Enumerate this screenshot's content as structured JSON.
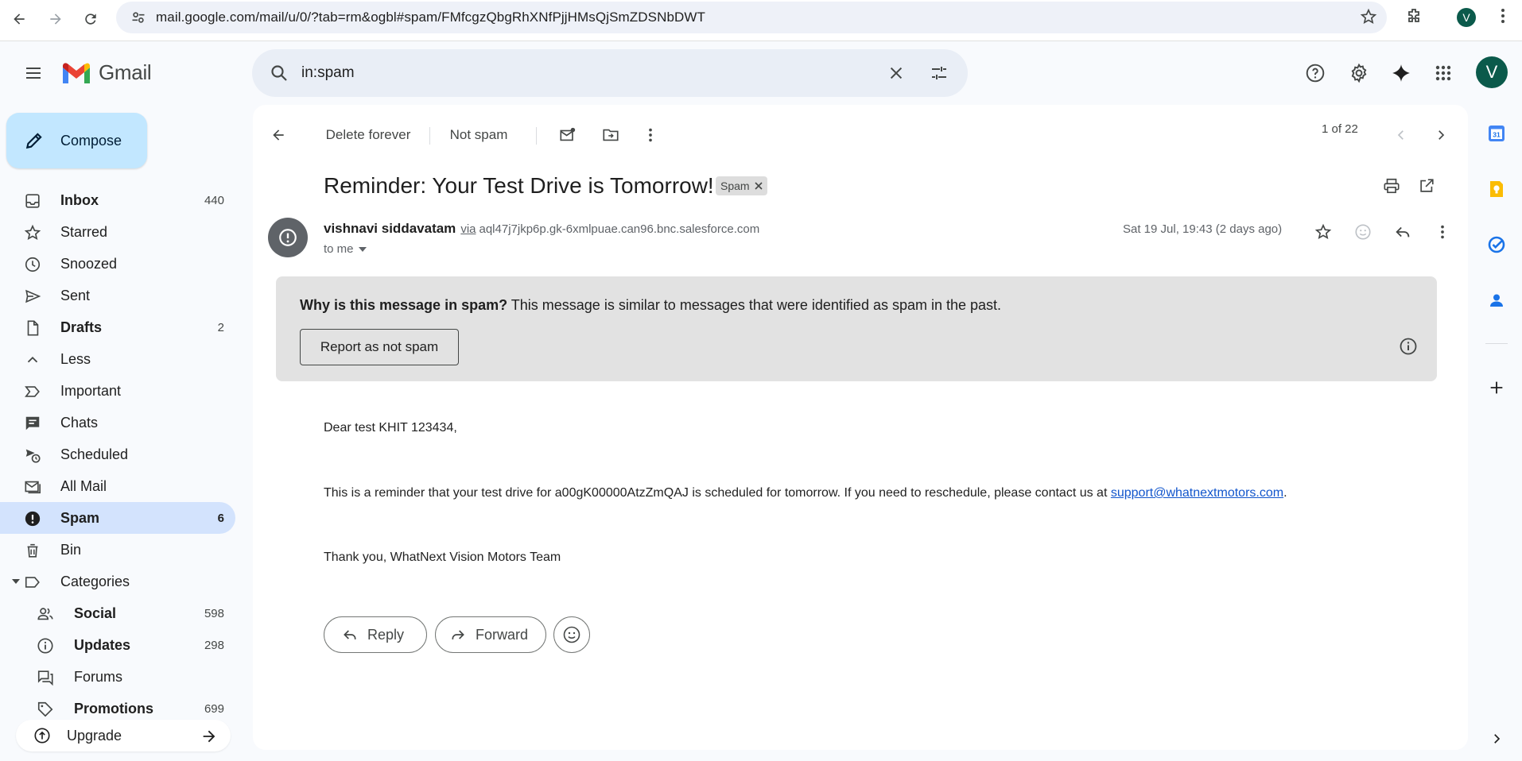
{
  "browser": {
    "url": "mail.google.com/mail/u/0/?tab=rm&ogbl#spam/FMfcgzQbgRhXNfPjjHMsQjSmZDSNbDWT",
    "profile_initial": "V"
  },
  "app": {
    "name": "Gmail",
    "account_initial": "V"
  },
  "search": {
    "value": "in:spam"
  },
  "compose": {
    "label": "Compose"
  },
  "sidebar": {
    "items": [
      {
        "label": "Inbox",
        "count": "440",
        "icon": "inbox-icon"
      },
      {
        "label": "Starred",
        "count": "",
        "icon": "star-icon"
      },
      {
        "label": "Snoozed",
        "count": "",
        "icon": "clock-icon"
      },
      {
        "label": "Sent",
        "count": "",
        "icon": "send-icon"
      },
      {
        "label": "Drafts",
        "count": "2",
        "icon": "draft-icon"
      },
      {
        "label": "Less",
        "count": "",
        "icon": "chevron-up-icon"
      },
      {
        "label": "Important",
        "count": "",
        "icon": "important-icon"
      },
      {
        "label": "Chats",
        "count": "",
        "icon": "chat-icon"
      },
      {
        "label": "Scheduled",
        "count": "",
        "icon": "scheduled-icon"
      },
      {
        "label": "All Mail",
        "count": "",
        "icon": "all-mail-icon"
      },
      {
        "label": "Spam",
        "count": "6",
        "icon": "spam-icon"
      },
      {
        "label": "Bin",
        "count": "",
        "icon": "trash-icon"
      },
      {
        "label": "Categories",
        "count": "",
        "icon": "label-icon"
      }
    ],
    "categories": [
      {
        "label": "Social",
        "count": "598",
        "icon": "people-icon"
      },
      {
        "label": "Updates",
        "count": "298",
        "icon": "info-icon"
      },
      {
        "label": "Forums",
        "count": "",
        "icon": "forum-icon"
      },
      {
        "label": "Promotions",
        "count": "699",
        "icon": "tag-icon"
      }
    ],
    "upgrade_label": "Upgrade"
  },
  "toolbar": {
    "delete_forever": "Delete forever",
    "not_spam": "Not spam",
    "pager": "1 of 22"
  },
  "message": {
    "subject": "Reminder: Your Test Drive is Tomorrow!",
    "label_badge": "Spam",
    "sender_name": "vishnavi siddavatam",
    "via": "via",
    "sender_address": "aql47j7jkp6p.gk-6xmlpuae.can96.bnc.salesforce.com",
    "to": "to me",
    "date": "Sat 19 Jul, 19:43 (2 days ago)",
    "spam_question": "Why is this message in spam?",
    "spam_explanation": " This message is similar to messages that were identified as spam in the past.",
    "report_not_spam": "Report as not spam",
    "greeting": "Dear test KHIT 123434,",
    "body_line": "This is a reminder that your test drive for a00gK00000AtzZmQAJ is scheduled for tomorrow. If you need to reschedule, please contact us at ",
    "support_email": "support@whatnextmotors.com",
    "body_end": ".",
    "signoff": "Thank you,  WhatNext Vision Motors Team"
  },
  "actions": {
    "reply": "Reply",
    "forward": "Forward"
  },
  "side_panel": {
    "calendar_day": "31"
  }
}
